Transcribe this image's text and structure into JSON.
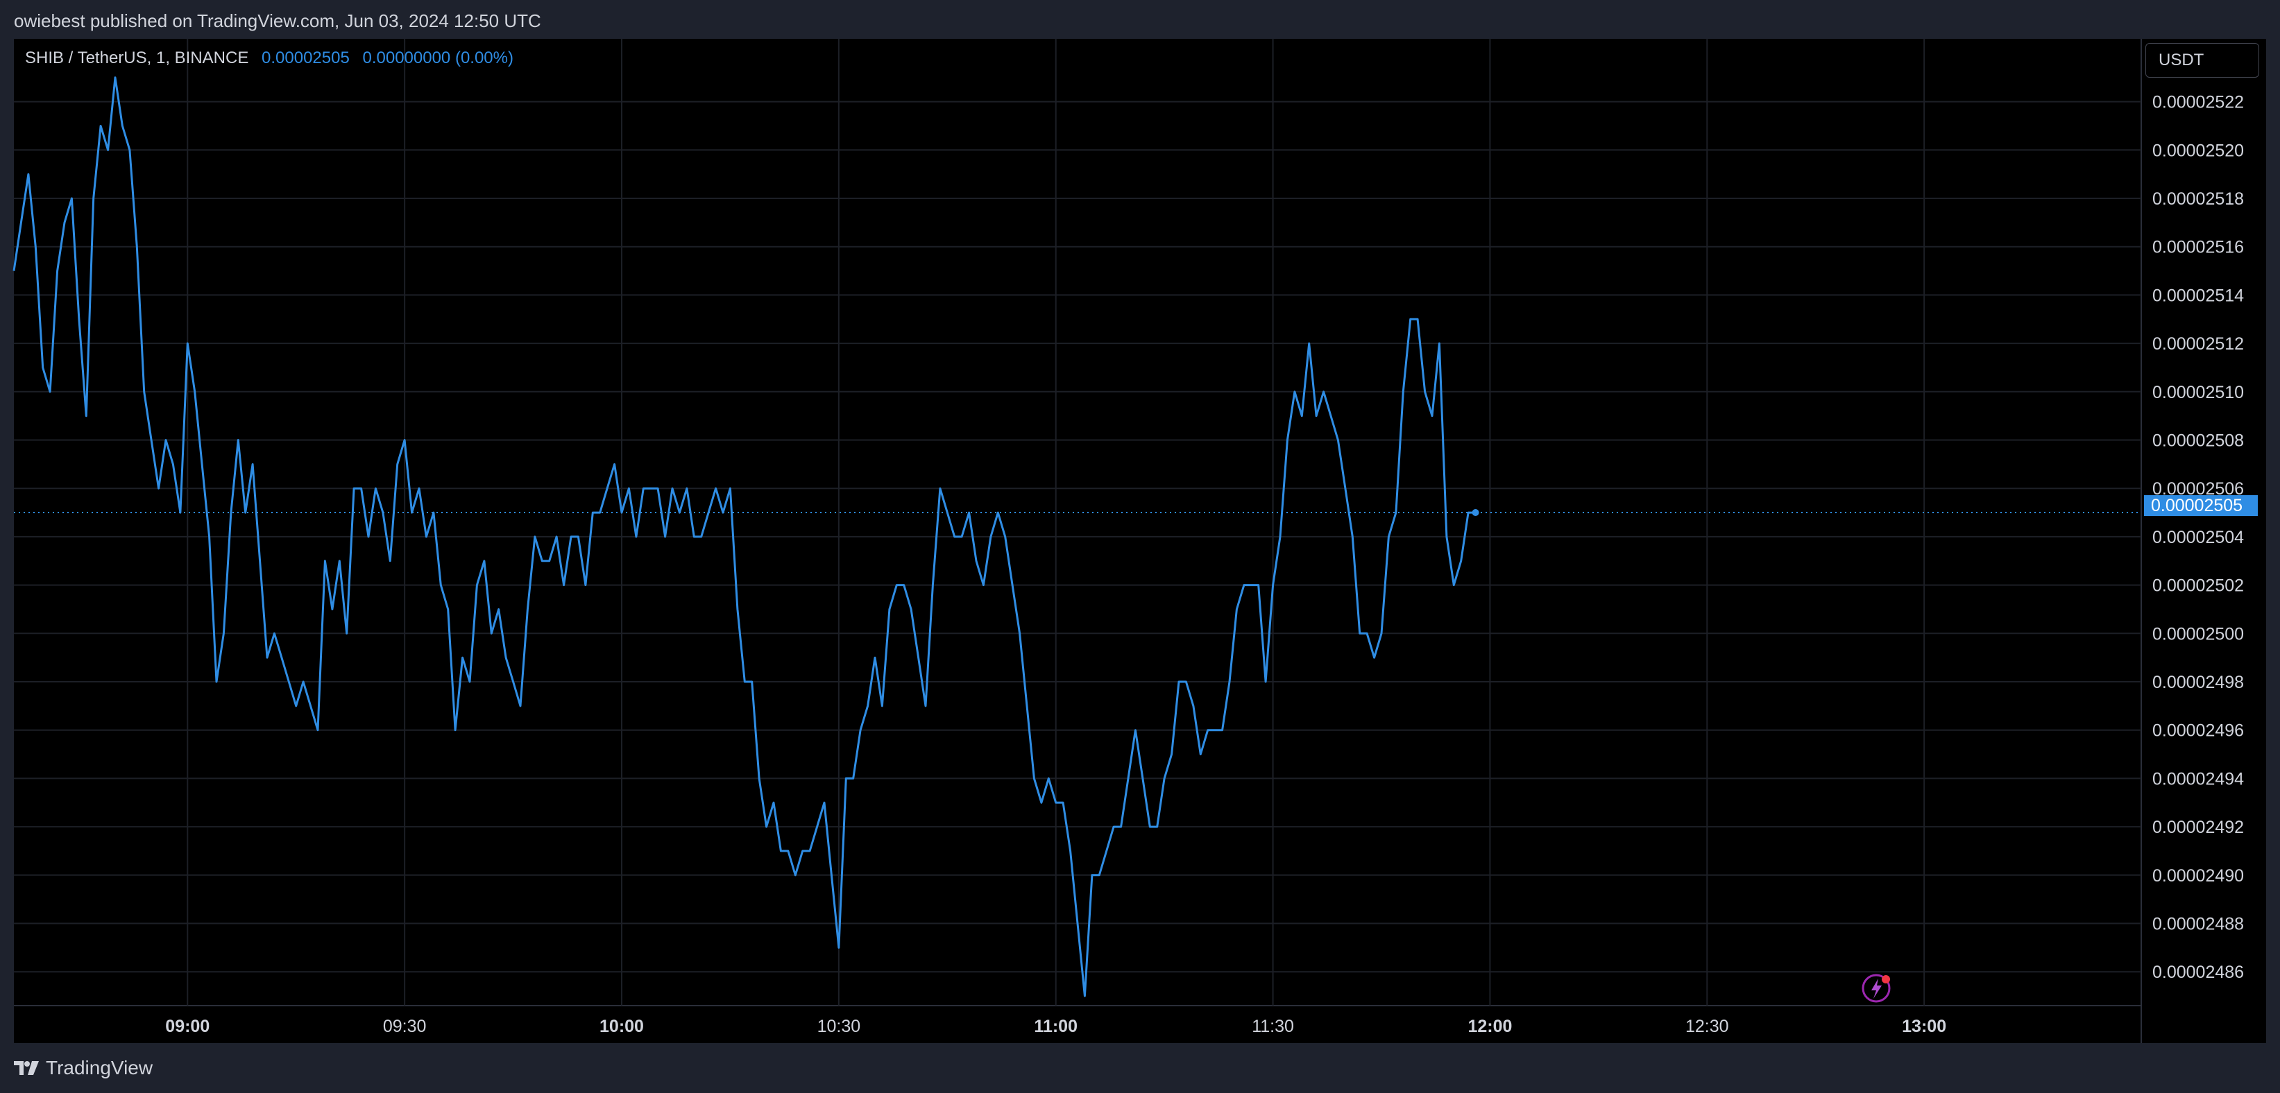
{
  "publisher_line": "owiebest published on TradingView.com, Jun 03, 2024 12:50 UTC",
  "legend": {
    "symbol": "SHIB / TetherUS, 1, BINANCE",
    "last": "0.00002505",
    "change": "0.00000000 (0.00%)"
  },
  "currency_button": "USDT",
  "brand": "TradingView",
  "colors": {
    "line": "#2f8de4",
    "background": "#000000",
    "grid": "#1c1f26",
    "axis_text": "#d1d4dc"
  },
  "icons": [
    "lightning-icon",
    "tradingview-logo-icon"
  ],
  "chart_data": {
    "type": "line",
    "title": "",
    "xlabel": "",
    "ylabel": "",
    "x_start_label": "08:36",
    "x_tick_labels": [
      {
        "label": "09:00",
        "t": 540,
        "bold": true
      },
      {
        "label": "09:30",
        "t": 570,
        "bold": false
      },
      {
        "label": "10:00",
        "t": 600,
        "bold": true
      },
      {
        "label": "10:30",
        "t": 630,
        "bold": false
      },
      {
        "label": "11:00",
        "t": 660,
        "bold": true
      },
      {
        "label": "11:30",
        "t": 690,
        "bold": false
      },
      {
        "label": "12:00",
        "t": 720,
        "bold": true
      },
      {
        "label": "12:30",
        "t": 750,
        "bold": false
      },
      {
        "label": "13:00",
        "t": 780,
        "bold": true
      }
    ],
    "y_tick_labels": [
      "0.00002486",
      "0.00002488",
      "0.00002490",
      "0.00002492",
      "0.00002494",
      "0.00002496",
      "0.00002498",
      "0.00002500",
      "0.00002502",
      "0.00002504",
      "0.00002506",
      "0.00002508",
      "0.00002510",
      "0.00002512",
      "0.00002514",
      "0.00002516",
      "0.00002518",
      "0.00002520",
      "0.00002522"
    ],
    "y_scale_factor": 1e-08,
    "y_ticks_scaled": [
      2486,
      2488,
      2490,
      2492,
      2494,
      2496,
      2498,
      2500,
      2502,
      2504,
      2506,
      2508,
      2510,
      2512,
      2514,
      2516,
      2518,
      2520,
      2522
    ],
    "xlim": [
      516,
      810
    ],
    "ylim_scaled": [
      2484.6,
      2524.6
    ],
    "last_price_label": "0.00002505",
    "last_price_scaled": 2505,
    "grid": true,
    "series": [
      {
        "t_start": 516,
        "t_step": 1,
        "values_scaled": [
          2515,
          2517,
          2519,
          2516,
          2511,
          2510,
          2515,
          2517,
          2518,
          2513,
          2509,
          2518,
          2521,
          2520,
          2523,
          2521,
          2520,
          2516,
          2510,
          2508,
          2506,
          2508,
          2507,
          2505,
          2512,
          2510,
          2507,
          2504,
          2498,
          2500,
          2505,
          2508,
          2505,
          2507,
          2503,
          2499,
          2500,
          2499,
          2498,
          2497,
          2498,
          2497,
          2496,
          2503,
          2501,
          2503,
          2500,
          2506,
          2506,
          2504,
          2506,
          2505,
          2503,
          2507,
          2508,
          2505,
          2506,
          2504,
          2505,
          2502,
          2501,
          2496,
          2499,
          2498,
          2502,
          2503,
          2500,
          2501,
          2499,
          2498,
          2497,
          2501,
          2504,
          2503,
          2503,
          2504,
          2502,
          2504,
          2504,
          2502,
          2505,
          2505,
          2506,
          2507,
          2505,
          2506,
          2504,
          2506,
          2506,
          2506,
          2504,
          2506,
          2505,
          2506,
          2504,
          2504,
          2505,
          2506,
          2505,
          2506,
          2501,
          2498,
          2498,
          2494,
          2492,
          2493,
          2491,
          2491,
          2490,
          2491,
          2491,
          2492,
          2493,
          2490,
          2487,
          2494,
          2494,
          2496,
          2497,
          2499,
          2497,
          2501,
          2502,
          2502,
          2501,
          2499,
          2497,
          2502,
          2506,
          2505,
          2504,
          2504,
          2505,
          2503,
          2502,
          2504,
          2505,
          2504,
          2502,
          2500,
          2497,
          2494,
          2493,
          2494,
          2493,
          2493,
          2491,
          2488,
          2485,
          2490,
          2490,
          2491,
          2492,
          2492,
          2494,
          2496,
          2494,
          2492,
          2492,
          2494,
          2495,
          2498,
          2498,
          2497,
          2495,
          2496,
          2496,
          2496,
          2498,
          2501,
          2502,
          2502,
          2502,
          2498,
          2502,
          2504,
          2508,
          2510,
          2509,
          2512,
          2509,
          2510,
          2509,
          2508,
          2506,
          2504,
          2500,
          2500,
          2499,
          2500,
          2504,
          2505,
          2510,
          2513,
          2513,
          2510,
          2509,
          2512,
          2504,
          2502,
          2503,
          2505,
          2505
        ]
      }
    ]
  }
}
